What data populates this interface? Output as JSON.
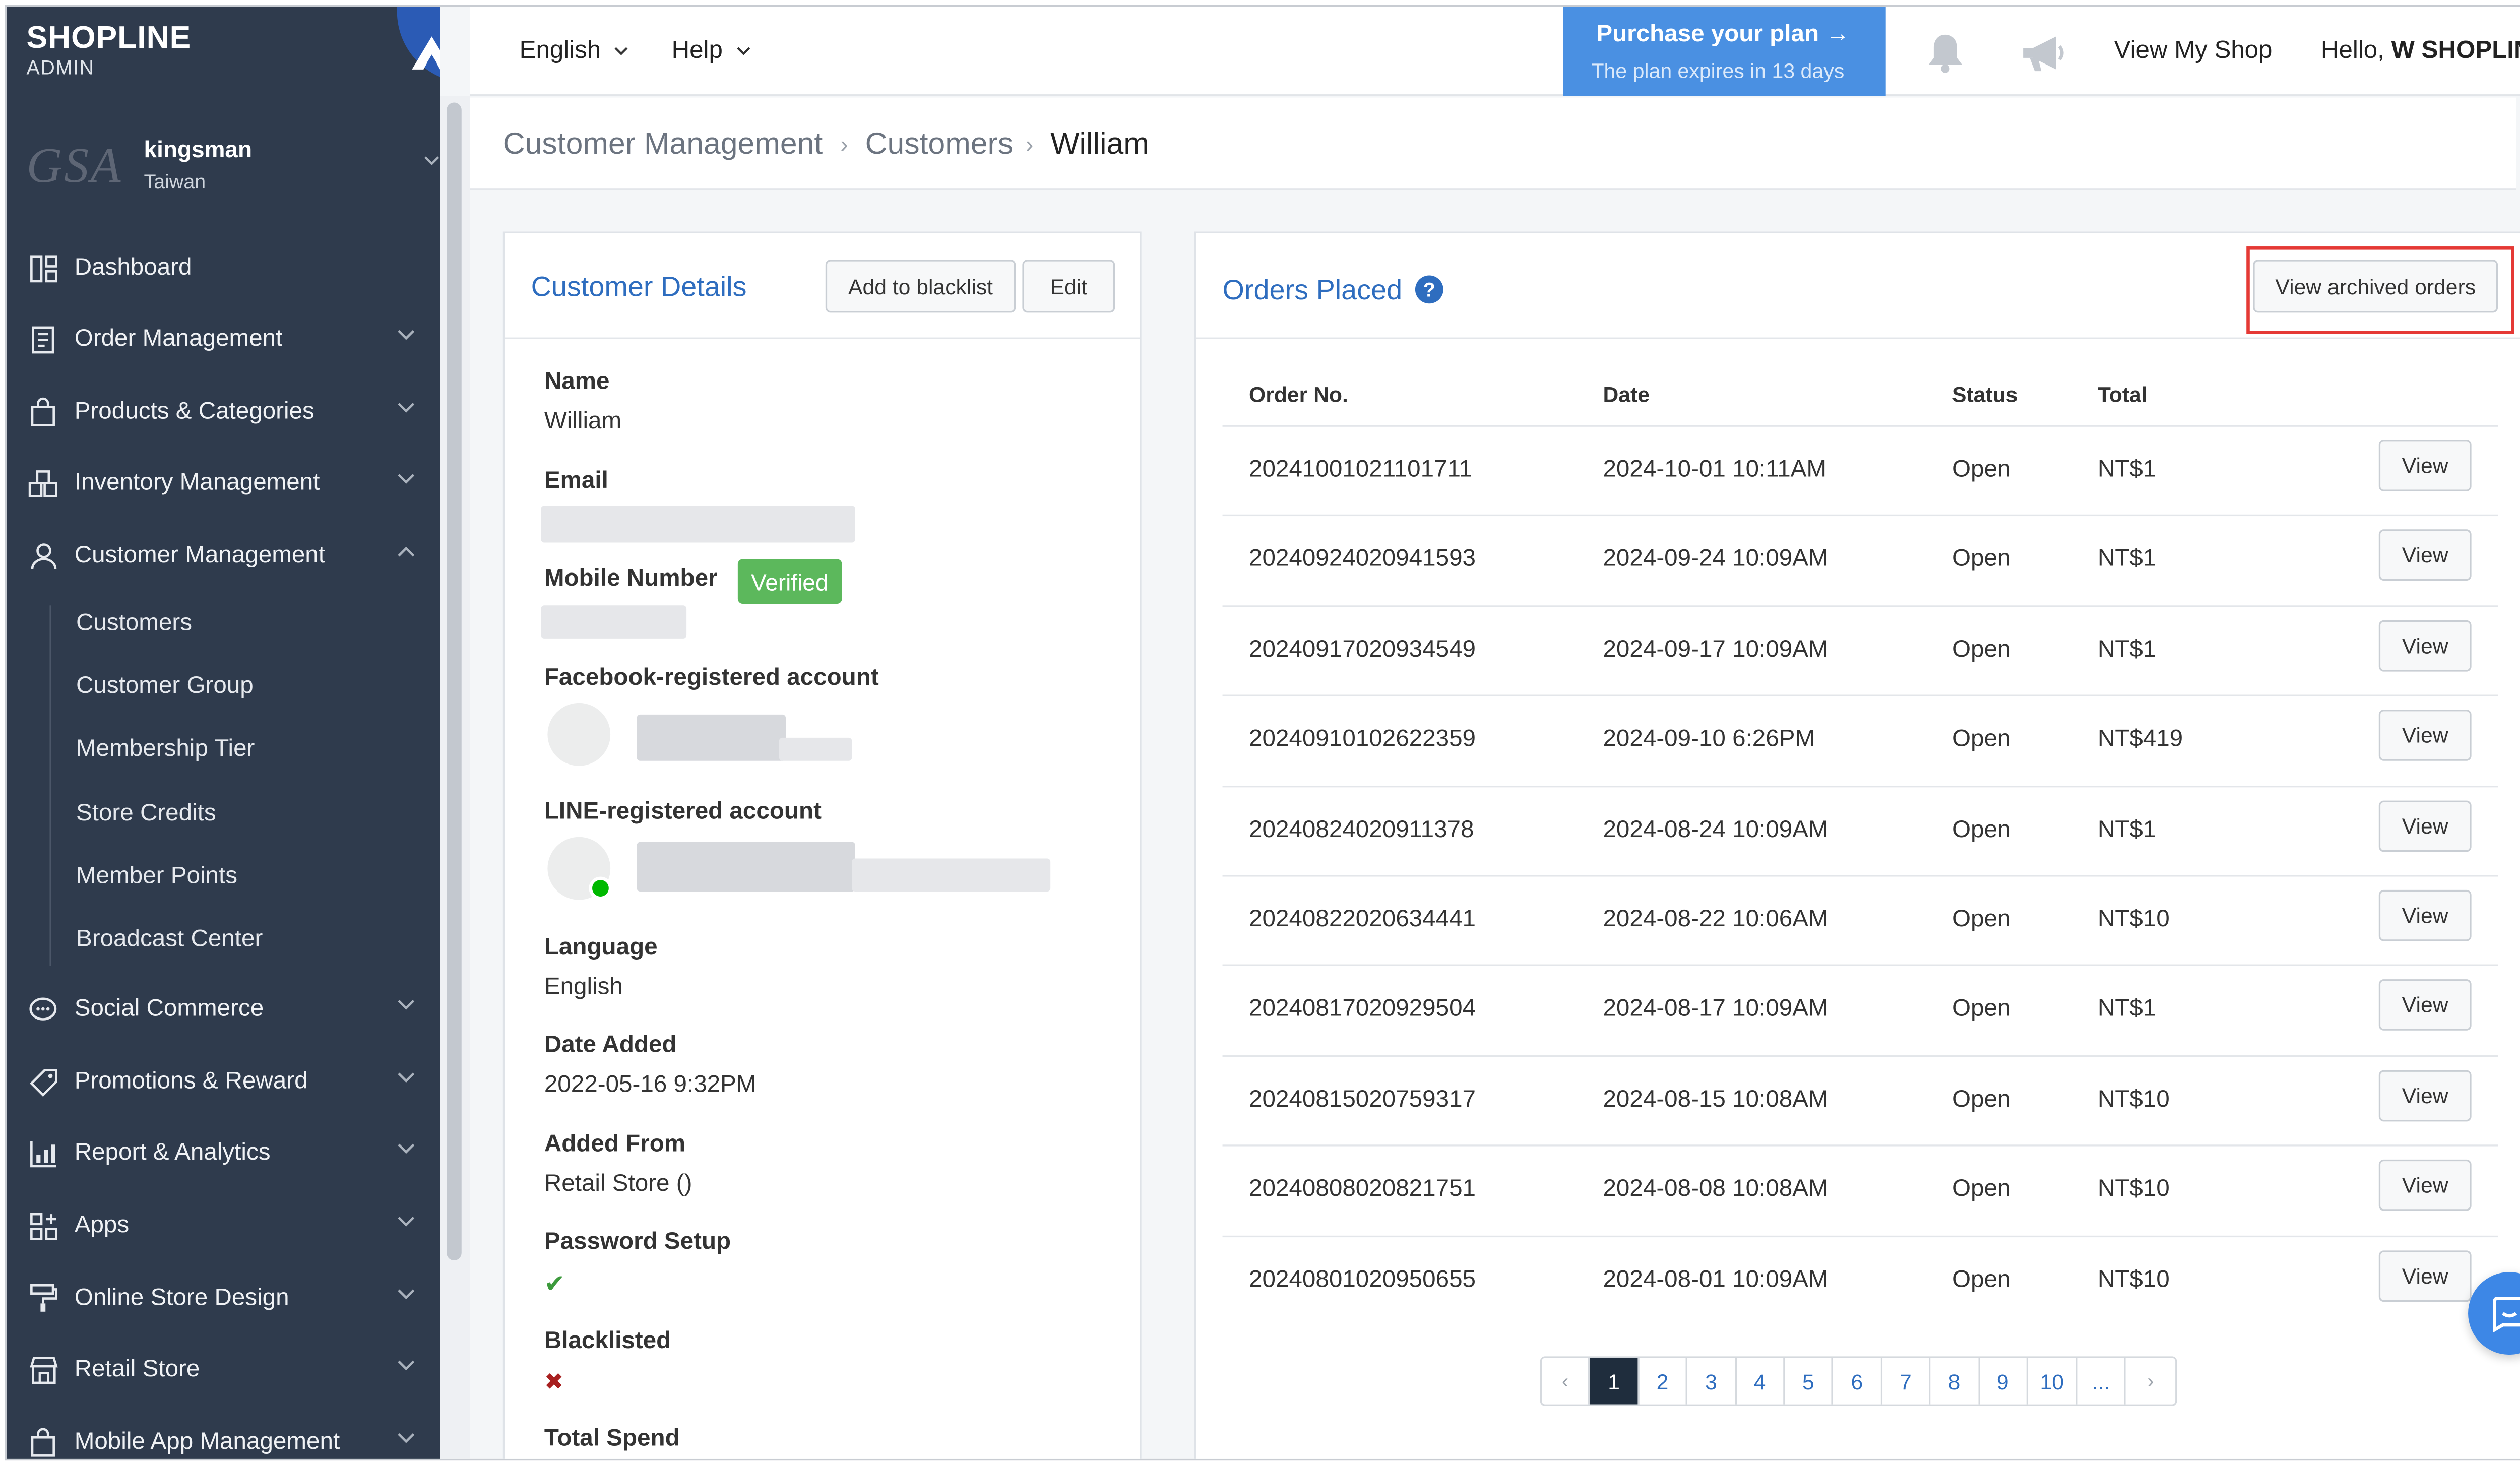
{
  "brand": {
    "name": "SHOPLINE",
    "sub": "ADMIN"
  },
  "store": {
    "logo_text": "GSA",
    "name": "kingsman",
    "region": "Taiwan"
  },
  "header": {
    "language": "English",
    "help": "Help",
    "purchase_title": "Purchase your plan →",
    "purchase_sub": "The plan expires in 13 days",
    "view_shop": "View My Shop",
    "hello_prefix": "Hello, ",
    "hello_name": "W SHOPLINE"
  },
  "sidebar": {
    "items": [
      {
        "label": "Dashboard",
        "icon": "dashboard-icon"
      },
      {
        "label": "Order Management",
        "icon": "receipt-icon"
      },
      {
        "label": "Products & Categories",
        "icon": "bag-icon"
      },
      {
        "label": "Inventory Management",
        "icon": "inventory-icon"
      },
      {
        "label": "Customer Management",
        "icon": "user-icon"
      },
      {
        "label": "Social Commerce",
        "icon": "chat-bubble-icon"
      },
      {
        "label": "Promotions & Reward",
        "icon": "tag-icon"
      },
      {
        "label": "Report & Analytics",
        "icon": "chart-icon"
      },
      {
        "label": "Apps",
        "icon": "apps-icon"
      },
      {
        "label": "Online Store Design",
        "icon": "paint-roller-icon"
      },
      {
        "label": "Retail Store",
        "icon": "store-icon"
      },
      {
        "label": "Mobile App Management",
        "icon": "mobile-bag-icon"
      }
    ],
    "subitems": [
      "Customers",
      "Customer Group",
      "Membership Tier",
      "Store Credits",
      "Member Points",
      "Broadcast Center"
    ]
  },
  "breadcrumb": [
    "Customer Management",
    "Customers",
    "William"
  ],
  "customer": {
    "title": "Customer Details",
    "blacklist_btn": "Add to blacklist",
    "edit_btn": "Edit",
    "name_label": "Name",
    "name": "William",
    "email_label": "Email",
    "mobile_label": "Mobile Number",
    "verified": "Verified",
    "facebook_label": "Facebook-registered account",
    "line_label": "LINE-registered account",
    "language_label": "Language",
    "language": "English",
    "date_added_label": "Date Added",
    "date_added": "2022-05-16 9:32PM",
    "added_from_label": "Added From",
    "added_from": "Retail Store ()",
    "password_label": "Password Setup",
    "password_mark": "✔",
    "blacklisted_label": "Blacklisted",
    "blacklisted_mark": "✖",
    "total_spend_label": "Total Spend"
  },
  "orders": {
    "title": "Orders Placed",
    "archived_btn": "View archived orders",
    "columns": [
      "Order No.",
      "Date",
      "Status",
      "Total"
    ],
    "view_label": "View",
    "rows": [
      {
        "no": "20241001021101711",
        "date": "2024-10-01 10:11AM",
        "status": "Open",
        "total": "NT$1"
      },
      {
        "no": "20240924020941593",
        "date": "2024-09-24 10:09AM",
        "status": "Open",
        "total": "NT$1"
      },
      {
        "no": "20240917020934549",
        "date": "2024-09-17 10:09AM",
        "status": "Open",
        "total": "NT$1"
      },
      {
        "no": "20240910102622359",
        "date": "2024-09-10 6:26PM",
        "status": "Open",
        "total": "NT$419"
      },
      {
        "no": "20240824020911378",
        "date": "2024-08-24 10:09AM",
        "status": "Open",
        "total": "NT$1"
      },
      {
        "no": "20240822020634441",
        "date": "2024-08-22 10:06AM",
        "status": "Open",
        "total": "NT$10"
      },
      {
        "no": "20240817020929504",
        "date": "2024-08-17 10:09AM",
        "status": "Open",
        "total": "NT$1"
      },
      {
        "no": "20240815020759317",
        "date": "2024-08-15 10:08AM",
        "status": "Open",
        "total": "NT$10"
      },
      {
        "no": "20240808020821751",
        "date": "2024-08-08 10:08AM",
        "status": "Open",
        "total": "NT$10"
      },
      {
        "no": "20240801020950655",
        "date": "2024-08-01 10:09AM",
        "status": "Open",
        "total": "NT$10"
      }
    ],
    "pagination": {
      "prev": "‹",
      "pages": [
        "1",
        "2",
        "3",
        "4",
        "5",
        "6",
        "7",
        "8",
        "9",
        "10"
      ],
      "ellipsis": "...",
      "next": "›",
      "current": "1"
    }
  },
  "colors": {
    "sidebar_bg": "#2f3b4d",
    "accent": "#2e6dbf",
    "purchase_bg": "#4a90e2",
    "verified": "#5cb85c",
    "highlight": "#e53935"
  }
}
